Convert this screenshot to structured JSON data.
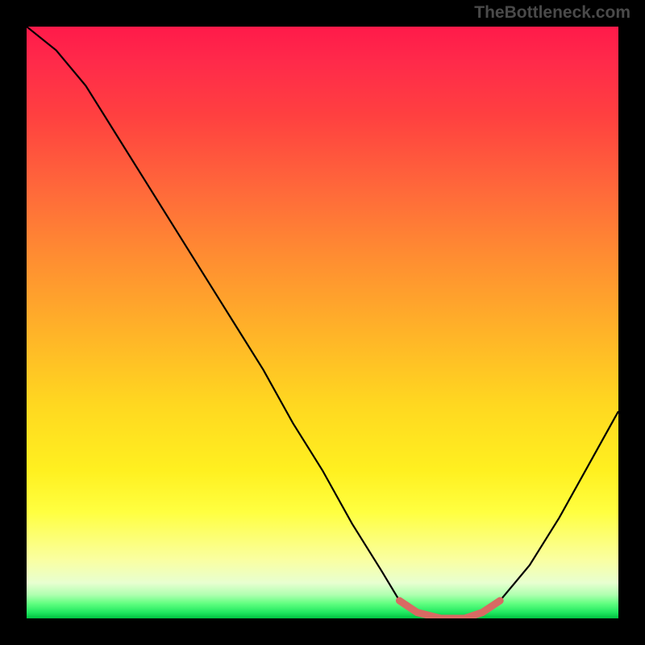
{
  "watermark": "TheBottleneck.com",
  "chart_data": {
    "type": "line",
    "title": "",
    "xlabel": "",
    "ylabel": "",
    "xlim": [
      0,
      100
    ],
    "ylim": [
      0,
      100
    ],
    "series": [
      {
        "name": "bottleneck-curve",
        "x": [
          0,
          5,
          10,
          15,
          20,
          25,
          30,
          35,
          40,
          45,
          50,
          55,
          60,
          63,
          66,
          70,
          74,
          77,
          80,
          85,
          90,
          95,
          100
        ],
        "values": [
          100,
          96,
          90,
          82,
          74,
          66,
          58,
          50,
          42,
          33,
          25,
          16,
          8,
          3,
          1,
          0,
          0,
          1,
          3,
          9,
          17,
          26,
          35
        ]
      }
    ],
    "annotations": [
      {
        "name": "optimal-band",
        "type": "highlight",
        "x_start": 63,
        "x_end": 80,
        "color": "#d86a63"
      }
    ],
    "background": {
      "type": "vertical-gradient",
      "stops": [
        {
          "pos": 0,
          "color": "#ff1a4a"
        },
        {
          "pos": 50,
          "color": "#ffb428"
        },
        {
          "pos": 82,
          "color": "#ffff40"
        },
        {
          "pos": 100,
          "color": "#00c040"
        }
      ]
    }
  }
}
